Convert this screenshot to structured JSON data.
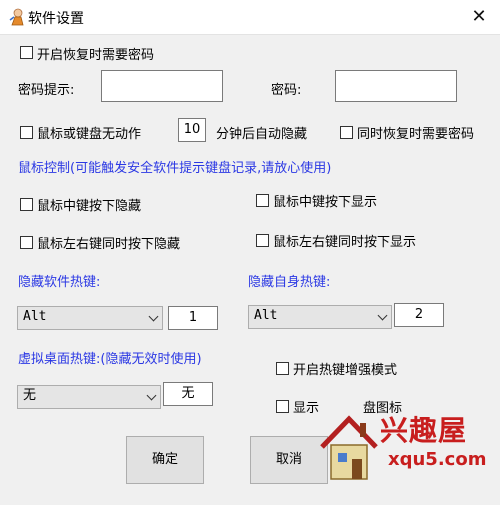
{
  "window": {
    "title": "软件设置",
    "close_glyph": "✕"
  },
  "restore_password": {
    "label": "开启恢复时需要密码"
  },
  "password_hint": {
    "label": "密码提示:",
    "value": ""
  },
  "password": {
    "label": "密码:",
    "value": ""
  },
  "idle": {
    "label": "鼠标或键盘无动作",
    "minutes": "10",
    "suffix": "分钟后自动隐藏"
  },
  "restore_also_password": {
    "label": "同时恢复时需要密码"
  },
  "mouse_control": {
    "heading": "鼠标控制(可能触发安全软件提示键盘记录,请放心使用)"
  },
  "mouse_options": {
    "middle_hide": "鼠标中键按下隐藏",
    "middle_show": "鼠标中键按下显示",
    "lr_hide": "鼠标左右键同时按下隐藏",
    "lr_show": "鼠标左右键同时按下显示"
  },
  "hotkeys": {
    "hide_software_label": "隐藏软件热键:",
    "hide_self_label": "隐藏自身热键:",
    "hide_software_modifier": "Alt",
    "hide_software_key": "1",
    "hide_self_modifier": "Alt",
    "hide_self_key": "2",
    "virtual_desktop_label": "虚拟桌面热键:(隐藏无效时使用)",
    "virtual_desktop_modifier": "无",
    "virtual_desktop_key": "无"
  },
  "enhanced_mode": {
    "label": "开启热键增强模式"
  },
  "tray": {
    "label": "显示",
    "label_end": "盘图标"
  },
  "buttons": {
    "ok": "确定",
    "cancel": "取消"
  },
  "watermark": {
    "brand": "兴趣屋",
    "domain": "xqu5.com"
  },
  "colors": {
    "heading_blue": "#2b38e4",
    "watermark_red": "#c81e1e"
  }
}
